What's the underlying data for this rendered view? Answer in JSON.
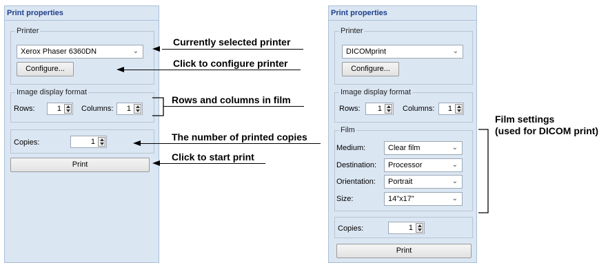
{
  "left_panel": {
    "title": "Print properties",
    "printer_group": {
      "legend": "Printer",
      "selected": "Xerox Phaser 6360DN",
      "configure_label": "Configure..."
    },
    "format_group": {
      "legend": "Image display format",
      "rows_label": "Rows:",
      "rows_value": "1",
      "columns_label": "Columns:",
      "columns_value": "1"
    },
    "copies_label": "Copies:",
    "copies_value": "1",
    "print_label": "Print"
  },
  "right_panel": {
    "title": "Print properties",
    "printer_group": {
      "legend": "Printer",
      "selected": "DICOMprint",
      "configure_label": "Configure..."
    },
    "format_group": {
      "legend": "Image display format",
      "rows_label": "Rows:",
      "rows_value": "1",
      "columns_label": "Columns:",
      "columns_value": "1"
    },
    "film_group": {
      "legend": "Film",
      "medium_label": "Medium:",
      "medium_value": "Clear film",
      "destination_label": "Destination:",
      "destination_value": "Processor",
      "orientation_label": "Orientation:",
      "orientation_value": "Portrait",
      "size_label": "Size:",
      "size_value": "14\"x17\""
    },
    "copies_label": "Copies:",
    "copies_value": "1",
    "print_label": "Print"
  },
  "annotations": {
    "selected_printer": "Currently selected printer",
    "configure": "Click to configure printer",
    "rows_columns": "Rows and columns in film",
    "copies": "The number of printed copies",
    "start_print": "Click to start print",
    "film_settings_line1": "Film settings",
    "film_settings_line2": "(used for DICOM print)"
  },
  "icons": {
    "dropdown": "chevron-down-icon",
    "spinner": "spinner-arrows-icon"
  }
}
